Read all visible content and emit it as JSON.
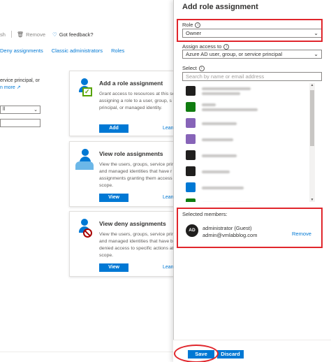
{
  "background": {
    "toolbar": {
      "refresh_label": "sh",
      "remove_label": "Remove",
      "feedback_label": "Got feedback?"
    },
    "tabs": [
      "Deny assignments",
      "Classic administrators",
      "Roles"
    ],
    "left_text_line1": "ervice principal, or",
    "left_text_link": "n more",
    "left_select_value": "ll",
    "cards": [
      {
        "title": "Add a role assignment",
        "desc_lines": [
          "Grant access to resources at this sc",
          "assigning a role to a user, group, s",
          "principal, or managed identity."
        ],
        "button_label": "Add",
        "learn_label": "Learn"
      },
      {
        "title": "View role assignments",
        "desc_lines": [
          "View the users, groups, service princ",
          "and managed identities that have r",
          "assignments granting them access",
          "scope."
        ],
        "button_label": "View",
        "learn_label": "Learn"
      },
      {
        "title": "View deny assignments",
        "desc_lines": [
          "View the users, groups, service princ",
          "and managed identities that have b",
          "denied access to specific actions at",
          "scope."
        ],
        "button_label": "View",
        "learn_label": "Learn"
      }
    ]
  },
  "blade": {
    "title": "Add role assignment",
    "role": {
      "label": "Role",
      "value": "Owner"
    },
    "assign_access": {
      "label": "Assign access to",
      "value": "Azure AD user, group, or service principal"
    },
    "select": {
      "label": "Select",
      "placeholder": "Search by name or email address"
    },
    "list_avatar_colors": [
      "#201f1e",
      "#107c10",
      "#8764b8",
      "#8764b8",
      "#201f1e",
      "#201f1e",
      "#0078d4",
      "#107c10"
    ],
    "selected_members_label": "Selected members:",
    "member": {
      "initials": "AD",
      "name": "administrator (Guest)",
      "email": "admin@vmlabblog.com",
      "remove_label": "Remove"
    },
    "footer": {
      "save_label": "Save",
      "discard_label": "Discard"
    }
  },
  "colors": {
    "accent": "#0078d4",
    "highlight": "#e0262c"
  }
}
